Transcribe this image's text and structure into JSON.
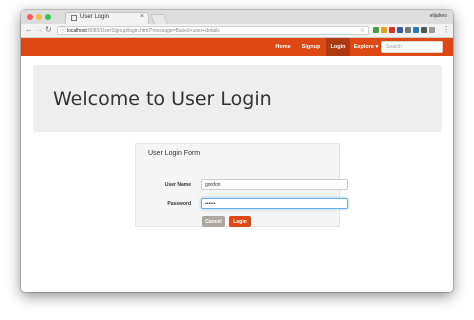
{
  "browser": {
    "tab_title": "User Login",
    "tab_close": "×",
    "profile_label": "elijaheo",
    "url_host": "localhost",
    "url_rest": ":8080/UserSignup/login.html?message=Based+user+details",
    "nav_back": "←",
    "nav_forward": "→",
    "nav_reload": "↻",
    "star": "☆",
    "menu": "⋮",
    "extension_colors": [
      "#4a9a4a",
      "#e4a11b",
      "#d93025",
      "#3b5998",
      "#777777",
      "#2b7bb9",
      "#555555",
      "#999999"
    ]
  },
  "navbar": {
    "color": "#dd4814",
    "items": [
      {
        "label": "Home"
      },
      {
        "label": "Signup"
      },
      {
        "label": "Login",
        "active": true
      },
      {
        "label": "Explore ▾"
      }
    ],
    "search_placeholder": "Search"
  },
  "jumbotron": {
    "title": "Welcome to User Login"
  },
  "form": {
    "title": "User Login Form",
    "username_label": "User Name",
    "username_value": "gordon",
    "password_label": "Password",
    "password_value": "••••••",
    "cancel_label": "Cancel",
    "login_label": "Login"
  }
}
